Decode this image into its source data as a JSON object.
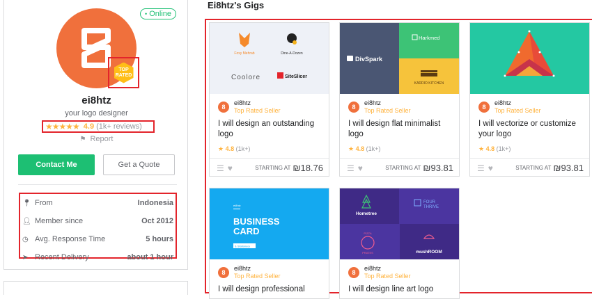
{
  "profile": {
    "status": "Online",
    "badge_line1": "TOP",
    "badge_line2": "RATED",
    "username": "ei8htz",
    "tagline": "your logo designer",
    "rating_score": "4.9",
    "rating_count": "(1k+ reviews)",
    "report": "Report",
    "contact_label": "Contact Me",
    "quote_label": "Get a Quote",
    "stats": [
      {
        "icon": "location-pin-icon",
        "label": "From",
        "value": "Indonesia"
      },
      {
        "icon": "user-icon",
        "label": "Member since",
        "value": "Oct 2012"
      },
      {
        "icon": "clock-icon",
        "label": "Avg. Response Time",
        "value": "5 hours"
      },
      {
        "icon": "send-icon",
        "label": "Recent Delivery",
        "value": "about 1 hour"
      }
    ]
  },
  "gigs": {
    "title": "Ei8htz's Gigs",
    "cards": [
      {
        "seller": "ei8htz",
        "level": "Top Rated Seller",
        "title": "I will design an outstanding logo",
        "rating": "4.8",
        "reviews": "(1k+)",
        "starting_at": "STARTING AT",
        "price": "₪18.76",
        "thumb_labels": [
          "Foxy Mehrab",
          "Dine-A-Dozen",
          "Coolore",
          "SiteSlicer"
        ]
      },
      {
        "seller": "ei8htz",
        "level": "Top Rated Seller",
        "title": "I will design flat minimalist logo",
        "rating": "4.8",
        "reviews": "(1k+)",
        "starting_at": "STARTING AT",
        "price": "₪93.81",
        "thumb_labels": [
          "DivSpark",
          "Harkmed",
          "KARDIO KITCHEN"
        ]
      },
      {
        "seller": "ei8htz",
        "level": "Top Rated Seller",
        "title": "I will vectorize or customize your logo",
        "rating": "4.8",
        "reviews": "(1k+)",
        "starting_at": "STARTING AT",
        "price": "₪93.81"
      },
      {
        "seller": "ei8htz",
        "level": "Top Rated Seller",
        "title": "I will design professional",
        "thumb_labels": [
          "ei8htz",
          "BUSINESS",
          "CARD",
          "& Stationery"
        ]
      },
      {
        "seller": "ei8htz",
        "level": "Top Rated Seller",
        "title": "I will design line art logo",
        "thumb_labels": [
          "Hometree",
          "FOUR",
          "THRIVE",
          "PIZZA",
          "PRATES",
          "mushROOM"
        ]
      }
    ]
  },
  "colors": {
    "accent_green": "#1dbf73",
    "star_gold": "#ffb33e",
    "highlight_red": "#e3242b",
    "avatar_orange": "#f0703c"
  }
}
